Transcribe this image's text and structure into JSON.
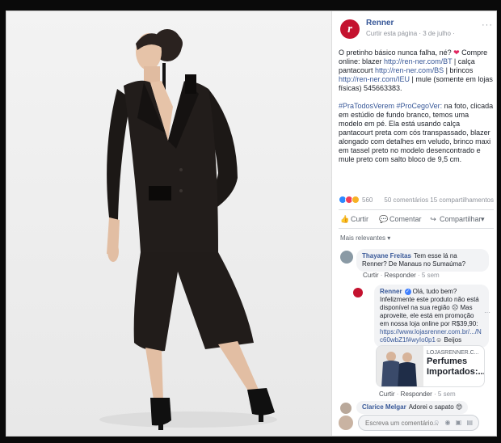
{
  "post_page": {
    "name": "Renner",
    "logo_letter": "r",
    "subline": "Curtir esta página · 3 de julho ·",
    "more": "···"
  },
  "post": {
    "p1_prefix": "O pretinho básico nunca falha, né? ",
    "p1_heart": "❤",
    "p1_mid": " Compre online: blazer ",
    "link1": "http://ren-ner.com/BT",
    "p1_a": " | calça pantacourt ",
    "link2": "http://ren-ner.com/BS",
    "p1_b": " | brincos ",
    "link3": "http://ren-ner.com/IEU",
    "p1_c": " | mule (somente em lojas físicas) 545663383.",
    "hashtags": "#PraTodosVerem #ProCegoVer:",
    "p2_rest": " na foto, clicada em estúdio de fundo branco, temos uma modelo em pé. Ela está usando calça pantacourt preta com cós transpassado, blazer alongado com detalhes em veludo, brinco maxi em tassel preto no modelo desencontrado e mule preto com salto bloco de 9,5 cm."
  },
  "stats": {
    "count": "560",
    "right": "50 comentários   15 compartilhamentos"
  },
  "actions": {
    "like": "Curtir",
    "comment": "Comentar",
    "share": "Compartilhar"
  },
  "relevant": "Mais relevantes ▾",
  "comments": {
    "c1": {
      "name": "Thayane Freitas",
      "text": "Tem esse lá na Renner? De Manaus no Sumaúma?",
      "like": "Curtir",
      "reply": "Responder",
      "time": "5 sem"
    },
    "reply": {
      "name": "Renner",
      "verified": "✓",
      "text": "Olá, tudo bem? Infelizmente este produto não está disponível na sua região ",
      "text2": " Mas aproveite, ele está em promoção em nossa loja online por R$39,90: ",
      "link": "https://www.lojasrenner.com.br/.../N c60wbZ1f#wyIo0p1",
      "tail": " Beijos",
      "like": "Curtir",
      "reply": "Responder",
      "time": "5 sem"
    },
    "card": {
      "domain": "LOJASRENNER.C...",
      "title": "Perfumes Importados:..."
    },
    "c2": {
      "name": "Clarice Melgar",
      "text": "Adorei o sapato",
      "reaction_emoji": "😍"
    }
  },
  "input": {
    "placeholder": "Escreva um comentário...",
    "tools": "☺ ◉ ▣ ▤"
  },
  "colors": {
    "brand": "#c4122f",
    "link": "#385898",
    "background": "#0a0a0a"
  }
}
